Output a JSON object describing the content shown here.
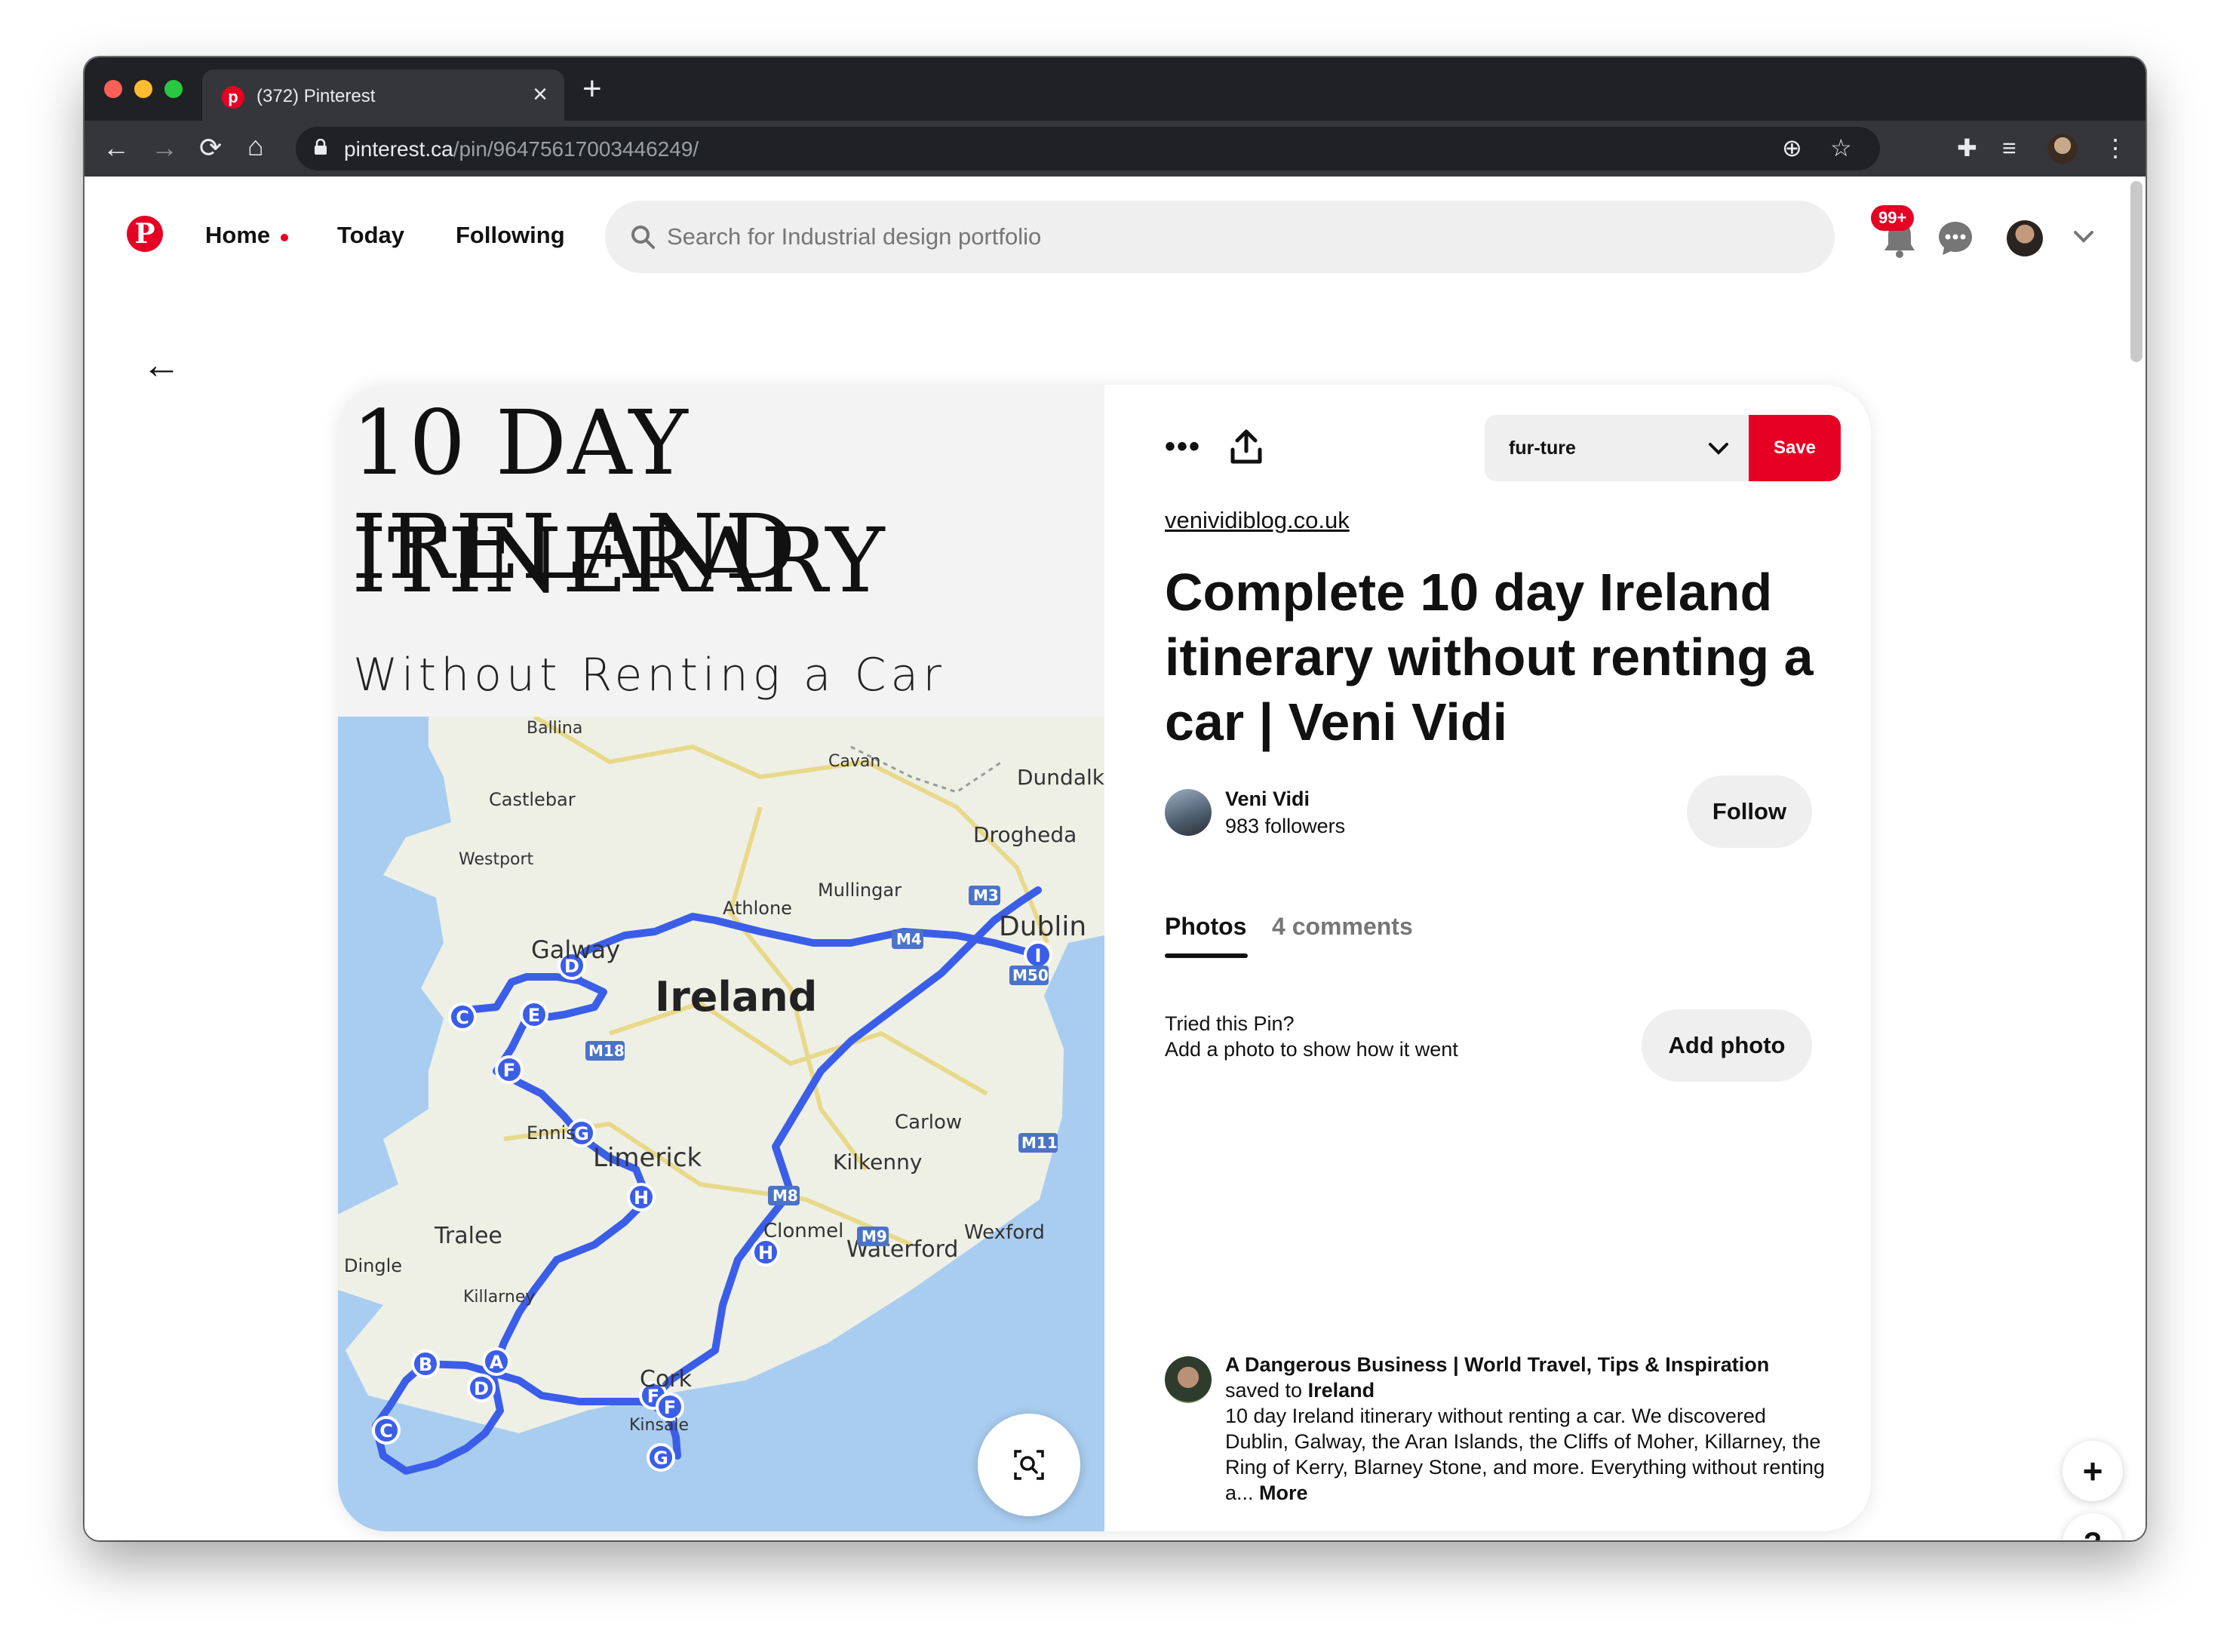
{
  "browser": {
    "tab_title": "(372) Pinterest",
    "url_host": "pinterest.ca",
    "url_path": "/pin/964756170034462​49/"
  },
  "header": {
    "nav": {
      "home": "Home",
      "today": "Today",
      "following": "Following"
    },
    "search_placeholder": "Search for Industrial design portfolio",
    "notifications_badge": "99+"
  },
  "pin_image": {
    "title_line1": "10 DAY IRELAND",
    "title_line2": "ITINERARY",
    "subtitle": "Without Renting a Car",
    "map": {
      "country_label": "Ireland",
      "places": [
        "Ballina",
        "Cavan",
        "Castlebar",
        "Dundalk",
        "Drogheda",
        "Westport",
        "Mullingar",
        "Athlone",
        "Dublin",
        "Galway",
        "Ennis",
        "Limerick",
        "Carlow",
        "Kilkenny",
        "Tralee",
        "Clonmel",
        "Waterford",
        "Wexford",
        "Dingle",
        "Killarney",
        "Cork",
        "Kinsale"
      ],
      "roads": [
        "M3",
        "M4",
        "M50",
        "M18",
        "M8",
        "M9",
        "M11"
      ],
      "route_markers": [
        "I",
        "D",
        "C",
        "E",
        "F",
        "G",
        "H",
        "H",
        "B",
        "A",
        "D",
        "C",
        "F",
        "F",
        "G"
      ]
    }
  },
  "detail": {
    "board_name": "fur-ture",
    "save_label": "Save",
    "source": "venividiblog.co.uk",
    "title": "Complete 10 day Ireland itinerary without renting a car | Veni Vidi",
    "creator": {
      "name": "Veni Vidi",
      "followers": "983 followers",
      "follow_label": "Follow"
    },
    "tabs": {
      "photos": "Photos",
      "comments": "4 comments"
    },
    "tried": {
      "line1": "Tried this Pin?",
      "line2": "Add a photo to show how it went",
      "button": "Add photo"
    },
    "saver": {
      "name": "A Dangerous Business | World Travel, Tips & Inspiration",
      "saved_to_prefix": "saved to",
      "board": "Ireland",
      "description": "10 day Ireland itinerary without renting a car. We discovered Dublin, Galway, the Aran Islands, the Cliffs of Moher, Killarney, the Ring of Kerry, Blarney Stone, and more. Everything without renting a...",
      "more": "More"
    }
  },
  "fab": {
    "add": "+",
    "help": "?"
  },
  "colors": {
    "brand": "#e60023",
    "route": "#3b5ee8",
    "water": "#a9cdf0",
    "land": "#eef0e6"
  }
}
